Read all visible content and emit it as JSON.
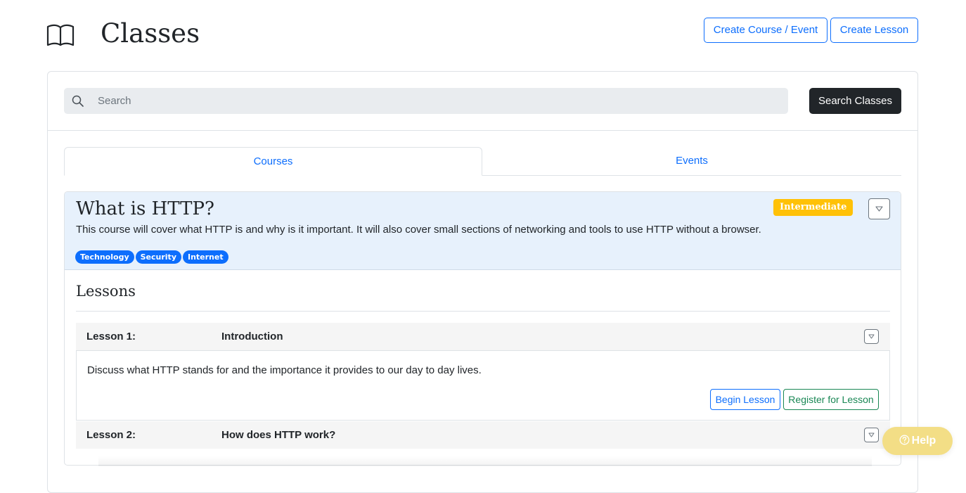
{
  "header": {
    "icon": "book-icon",
    "title": "Classes",
    "create_course_label": "Create Course / Event",
    "create_lesson_label": "Create Lesson"
  },
  "search": {
    "placeholder": "Search",
    "value": "",
    "button_label": "Search Classes"
  },
  "tabs": [
    {
      "label": "Courses",
      "active": true
    },
    {
      "label": "Events",
      "active": false
    }
  ],
  "course": {
    "title": "What is HTTP?",
    "level": "Intermediate",
    "description": "This course will cover what HTTP is and why is it important. It will also cover small sections of networking and tools to use HTTP without a browser.",
    "tags": [
      "Technology",
      "Security",
      "Internet"
    ],
    "lessons_heading": "Lessons",
    "lessons": [
      {
        "number": "Lesson 1:",
        "title": "Introduction",
        "expanded": true,
        "description": "Discuss what HTTP stands for and the importance it provides to our day to day lives.",
        "begin_label": "Begin Lesson",
        "register_label": "Register for Lesson"
      },
      {
        "number": "Lesson 2:",
        "title": "How does HTTP work?",
        "expanded": false
      }
    ]
  },
  "help": {
    "label": "Help",
    "icon": "question-circle-icon"
  },
  "colors": {
    "primary": "#0d6efd",
    "success": "#198754",
    "warning": "#ffc107",
    "dark": "#212529",
    "course_header_bg": "#e7f1fc",
    "help_bg": "#f3de86"
  }
}
